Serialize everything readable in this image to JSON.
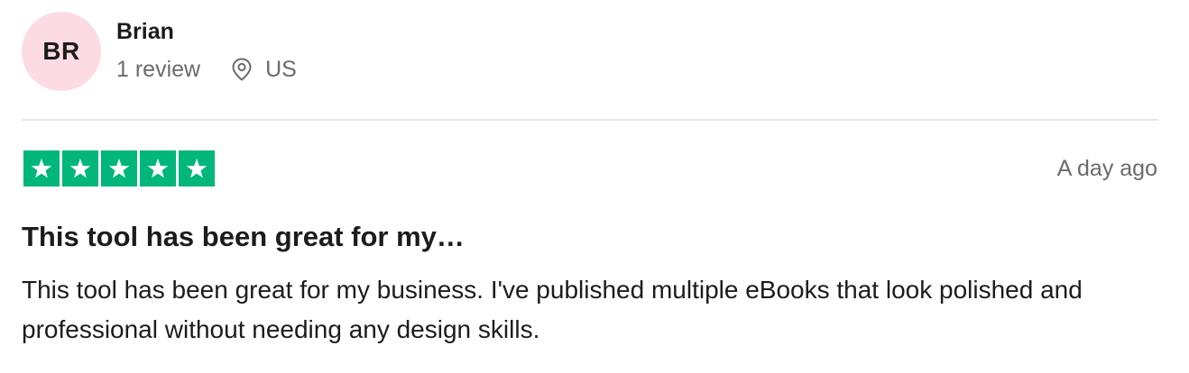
{
  "reviewer": {
    "initials": "BR",
    "name": "Brian",
    "review_count": "1 review",
    "location": "US",
    "avatar_color": "#fcdbe3"
  },
  "review": {
    "rating": 5,
    "rating_max": 5,
    "star_color": "#00b67a",
    "date": "A day ago",
    "title": "This tool has been great for my…",
    "body": "This tool has been great for my business. I've published multiple eBooks that look polished and professional without needing any design skills."
  },
  "icons": {
    "location": "map-pin-icon",
    "star": "star-icon"
  }
}
